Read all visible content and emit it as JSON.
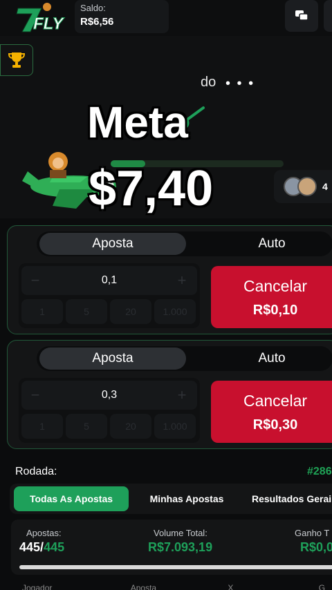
{
  "header": {
    "logo_text": "7FLY",
    "balance_label": "Saldo:",
    "balance_value": "R$6,56"
  },
  "game": {
    "waiting_text": "do",
    "dots": "• • •",
    "progress_fraction": 0.2,
    "players_count": "4"
  },
  "overlay": {
    "title": "Meta",
    "amount": "$7,40"
  },
  "bets": [
    {
      "tab_active": "Aposta",
      "tab_inactive": "Auto",
      "stake_value": "0,1",
      "minus": "−",
      "plus": "+",
      "quick_values": [
        "1",
        "5",
        "20",
        "1.000"
      ],
      "action_label": "Cancelar",
      "action_amount": "R$0,10"
    },
    {
      "tab_active": "Aposta",
      "tab_inactive": "Auto",
      "stake_value": "0,3",
      "minus": "−",
      "plus": "+",
      "quick_values": [
        "1",
        "5",
        "20",
        "1.000"
      ],
      "action_label": "Cancelar",
      "action_amount": "R$0,30"
    }
  ],
  "round": {
    "label": "Rodada:",
    "id": "#286",
    "filters": [
      "Todas As Apostas",
      "Minhas Apostas",
      "Resultados Gerai"
    ],
    "stats": {
      "bets_label": "Apostas:",
      "bets_count": "445",
      "bets_separator": "/",
      "bets_total": "445",
      "volume_label": "Volume Total:",
      "volume_value": "R$7.093,19",
      "gain_label": "Ganho T",
      "gain_value": "R$0,0"
    },
    "bottom_headers": [
      "Jogador",
      "Aposta",
      "X",
      "G"
    ]
  },
  "colors": {
    "accent_green": "#1ea05a",
    "cancel_red": "#c8102e",
    "panel_border": "#22593a"
  }
}
